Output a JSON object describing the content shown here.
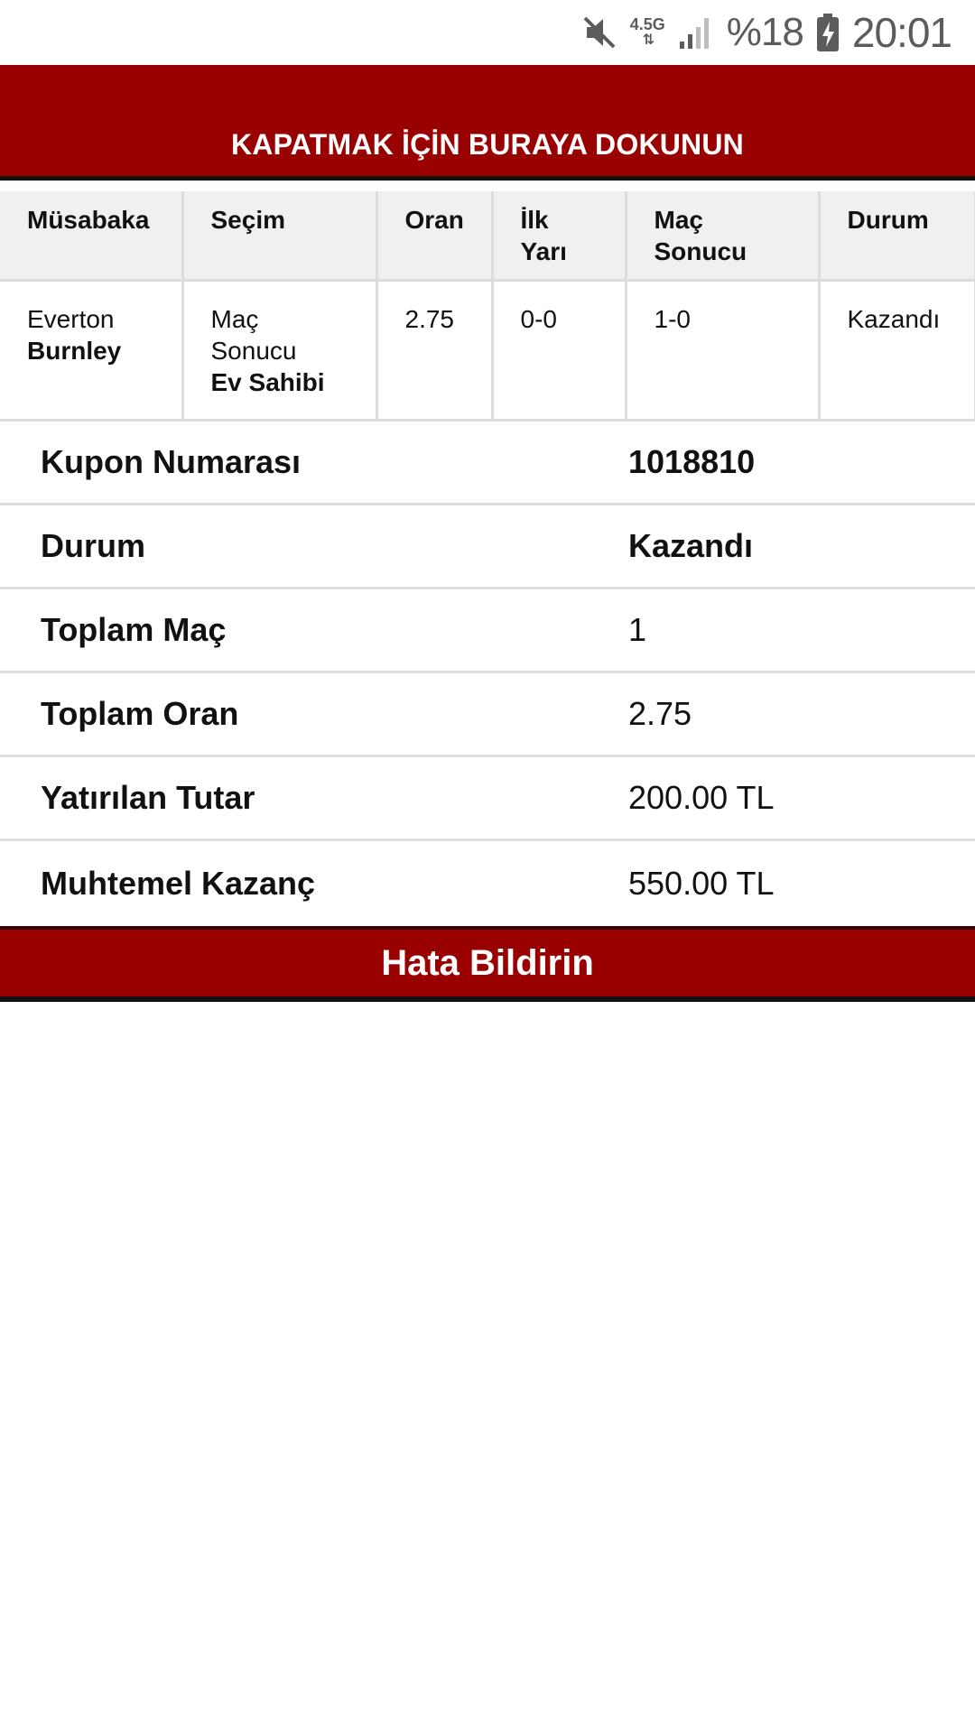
{
  "status_bar": {
    "icons": [
      "mute-icon",
      "signal-icon",
      "battery-charging-icon"
    ],
    "network_type": "4.5G",
    "battery_percent": "%18",
    "time": "20:01"
  },
  "close_banner": {
    "label": "KAPATMAK İÇİN BURAYA DOKUNUN"
  },
  "match_table": {
    "headers": {
      "event": "Müsabaka",
      "selection": "Seçim",
      "odds": "Oran",
      "first_half": [
        "İlk",
        "Yarı"
      ],
      "result": [
        "Maç",
        "Sonucu"
      ],
      "status": "Durum"
    },
    "rows": [
      {
        "home_team": "Everton",
        "away_team": "Burnley",
        "market": [
          "Maç",
          "Sonucu"
        ],
        "pick": "Ev Sahibi",
        "odds": "2.75",
        "first_half": "0-0",
        "result": "1-0",
        "status": "Kazandı"
      }
    ]
  },
  "summary": {
    "coupon_number_label": "Kupon Numarası",
    "coupon_number_value": "1018810",
    "status_label": "Durum",
    "status_value": "Kazandı",
    "total_matches_label": "Toplam Maç",
    "total_matches_value": "1",
    "total_odds_label": "Toplam Oran",
    "total_odds_value": "2.75",
    "stake_label": "Yatırılan Tutar",
    "stake_value": "200.00 TL",
    "potential_win_label": "Muhtemel Kazanç",
    "potential_win_value": "550.00 TL"
  },
  "report_button": {
    "label": "Hata Bildirin"
  },
  "colors": {
    "brand_red": "#990000",
    "border_gray": "#dddddd",
    "header_bg": "#f0f0f0"
  }
}
